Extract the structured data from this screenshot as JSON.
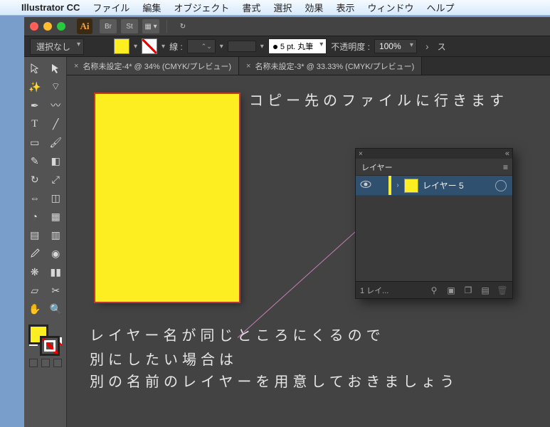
{
  "mac_menu": {
    "app_name": "Illustrator CC",
    "items": [
      "ファイル",
      "編集",
      "オブジェクト",
      "書式",
      "選択",
      "効果",
      "表示",
      "ウィンドウ",
      "ヘルプ"
    ]
  },
  "titlebar": {
    "logo": "Ai",
    "btn_br": "Br",
    "btn_st": "St"
  },
  "control": {
    "selection_label": "選択なし",
    "stroke_label": "線 :",
    "brush_label": "5 pt. 丸筆",
    "opacity_label": "不透明度 :",
    "opacity_value": "100%"
  },
  "tabs": [
    {
      "label": "名称未設定-4* @ 34% (CMYK/プレビュー)",
      "active": true
    },
    {
      "label": "名称未設定-3* @ 33.33% (CMYK/プレビュー)",
      "active": false
    }
  ],
  "layers_panel": {
    "title": "レイヤー",
    "layer_name": "レイヤー 5",
    "status": "1 レイ..."
  },
  "annotations": {
    "line1": "コピー先のファイルに行きます",
    "line2": "レイヤー名が同じところにくるので",
    "line3": "別にしたい場合は",
    "line4": "別の名前のレイヤーを用意しておきましょう"
  }
}
